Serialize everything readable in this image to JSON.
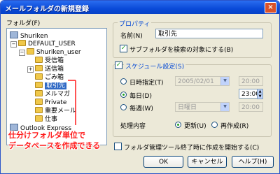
{
  "window": {
    "title": "メールフォルダの新規登録",
    "close": "×"
  },
  "folder_label": "フォルダ(F)",
  "tree": {
    "items": [
      {
        "label": "Shuriken"
      },
      {
        "label": "DEFAULT_USER"
      },
      {
        "label": "Shuriken_user"
      },
      {
        "label": "受信箱"
      },
      {
        "label": "送信箱"
      },
      {
        "label": "ごみ箱"
      },
      {
        "label": "取引先"
      },
      {
        "label": "メルマガ"
      },
      {
        "label": "Private"
      },
      {
        "label": "重要メール"
      },
      {
        "label": "仕事"
      },
      {
        "label": "Outlook Express"
      }
    ],
    "expanders": {
      "collapse": "−",
      "expand": "+"
    }
  },
  "properties": {
    "caption": "プロパティ",
    "name_label": "名前(N)",
    "name_value": "取引先",
    "subfolder_checkbox": "サブフォルダを検索の対象にする(B)"
  },
  "schedule": {
    "caption": "スケジュール設定(S)",
    "once_label": "日時指定(T)",
    "once_date": "2005/02/01",
    "once_time": "20:00",
    "daily_label": "毎日(D)",
    "daily_time": "23:00",
    "weekly_label": "毎週(W)",
    "weekly_day": "日曜日",
    "weekly_time": "20:00",
    "process_label": "処理内容",
    "update_label": "更新(U)",
    "recreate_label": "再作成(R)"
  },
  "footer_checkbox": "フォルダ管理ツール終了時に作成を開始する(C)",
  "buttons": {
    "ok": "OK",
    "cancel": "キャンセル",
    "help": "ヘルプ(H)"
  },
  "annotation": {
    "line1": "仕分けフォルダ単位で",
    "line2": "データベースを作成できる"
  }
}
